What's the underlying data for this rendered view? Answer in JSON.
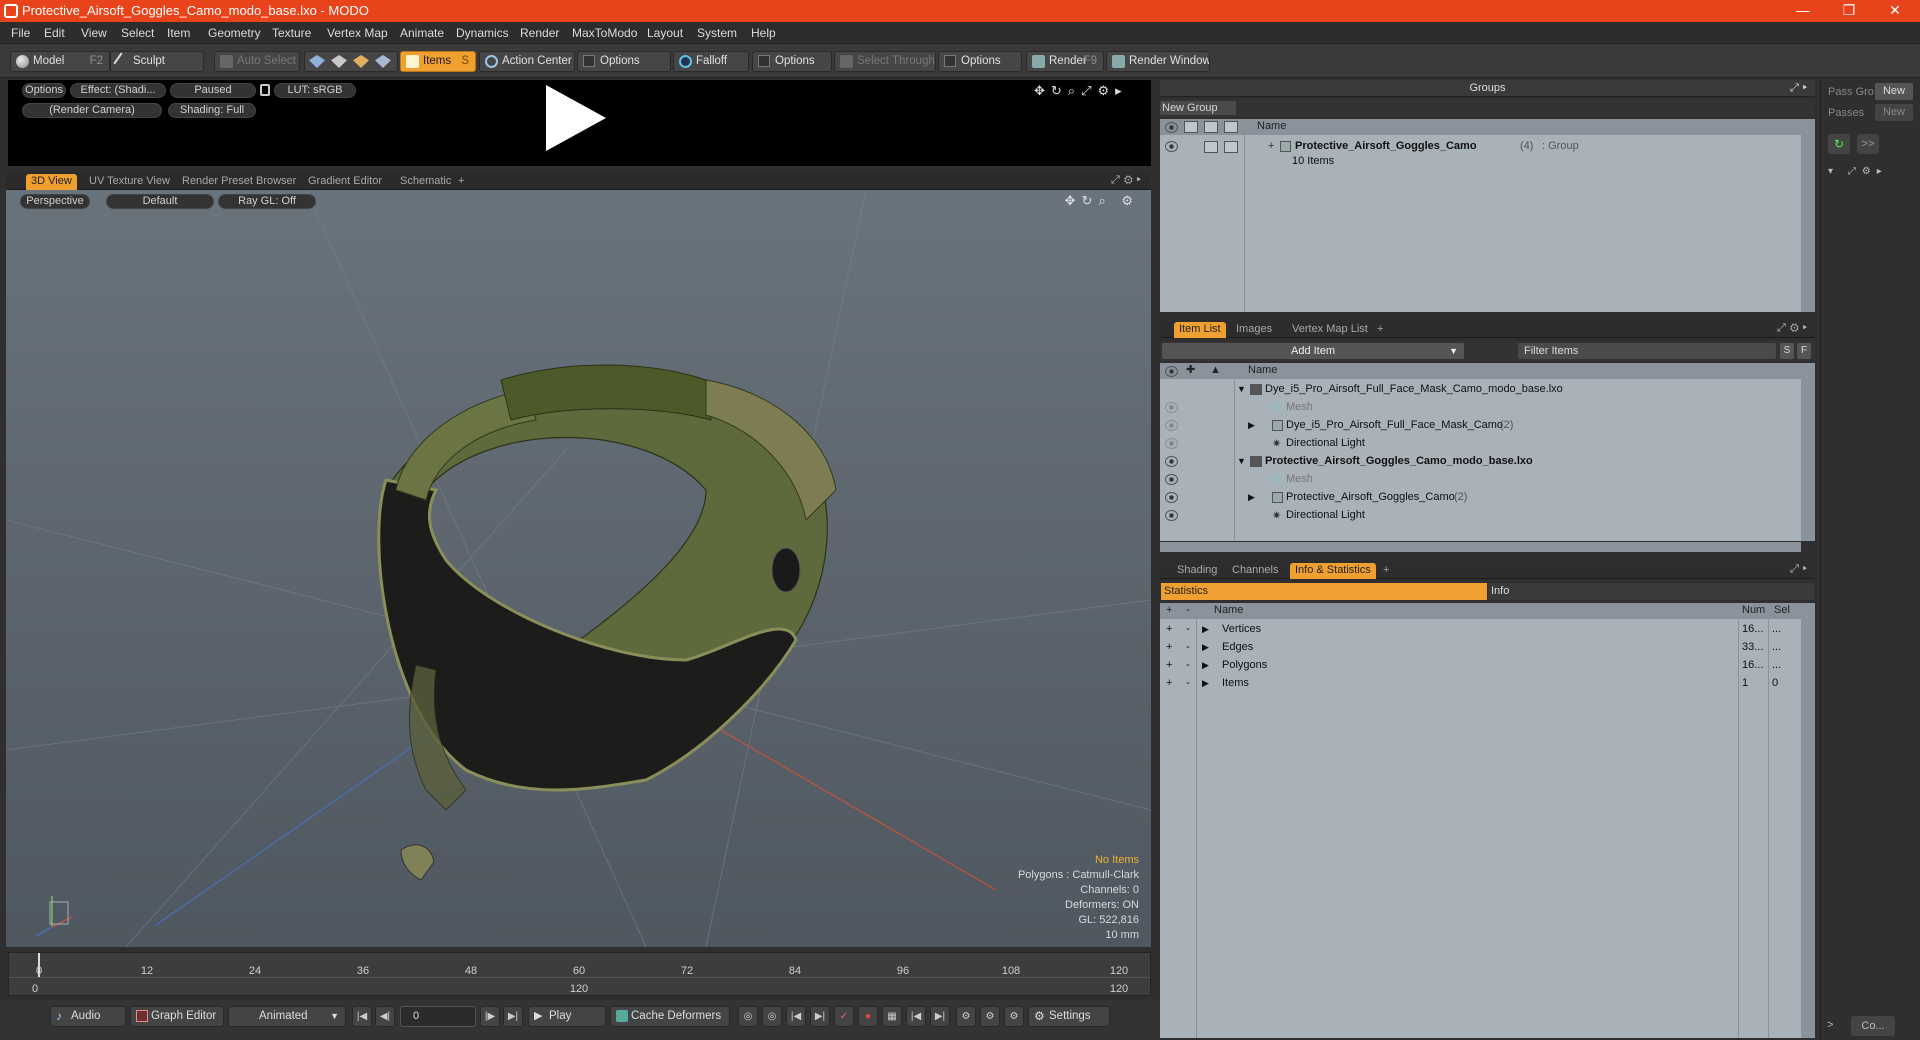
{
  "window": {
    "title": "Protective_Airsoft_Goggles_Camo_modo_base.lxo - MODO",
    "minimize": "—",
    "maximize": "❐",
    "close": "✕"
  },
  "menu": [
    "File",
    "Edit",
    "View",
    "Select",
    "Item",
    "Geometry",
    "Texture",
    "Vertex Map",
    "Animate",
    "Dynamics",
    "Render",
    "MaxToModo",
    "Layout",
    "System",
    "Help"
  ],
  "toolbar": {
    "model": "Model",
    "model_key": "F2",
    "sculpt": "Sculpt",
    "auto_select": "Auto Select",
    "items": "Items",
    "items_key": "S",
    "action_center": "Action Center",
    "options1": "Options",
    "falloff": "Falloff",
    "options2": "Options",
    "select_through": "Select Through",
    "options3": "Options",
    "render": "Render",
    "render_key": "F9",
    "render_window": "Render Window"
  },
  "preview": {
    "options": "Options",
    "effect": "Effect: (Shadi...",
    "paused": "Paused",
    "lut": "LUT: sRGB",
    "camera": "(Render Camera)",
    "shading": "Shading: Full"
  },
  "view_tabs": [
    "3D View",
    "UV Texture View",
    "Render Preset Browser",
    "Gradient Editor",
    "Schematic",
    "+"
  ],
  "viewport": {
    "perspective": "Perspective",
    "default": "Default",
    "raygl": "Ray GL: Off",
    "hud": {
      "no_items": "No Items",
      "polygons": "Polygons : Catmull-Clark",
      "channels": "Channels: 0",
      "deformers": "Deformers: ON",
      "gl": "GL: 522,816",
      "scale": "10 mm"
    }
  },
  "timeline": {
    "ticks": [
      "0",
      "12",
      "24",
      "36",
      "48",
      "60",
      "72",
      "84",
      "96",
      "108",
      "120"
    ],
    "frames": [
      "0",
      "120",
      "120"
    ]
  },
  "bottombar": {
    "audio": "Audio",
    "graph_editor": "Graph Editor",
    "animated": "Animated",
    "frame": "0",
    "play": "Play",
    "cache_deformers": "Cache Deformers",
    "settings": "Settings"
  },
  "groups": {
    "title": "Groups",
    "new_group": "New Group",
    "col_name": "Name",
    "row_name": "Protective_Airsoft_Goggles_Camo",
    "row_count": "(4)",
    "row_type": ": Group",
    "row_sub": "10 Items"
  },
  "pass": {
    "pass_groups": "Pass Gro",
    "passes": "Passes",
    "new1": "New",
    "new2": "New",
    "co": "Co..."
  },
  "itemlist": {
    "tabs": [
      "Item List",
      "Images",
      "Vertex Map List",
      "+"
    ],
    "add_item": "Add Item",
    "filter": "Filter Items",
    "s": "S",
    "f": "F",
    "col_name": "Name",
    "rows": [
      {
        "name": "Dye_i5_Pro_Airsoft_Full_Face_Mask_Camo_modo_base.lxo",
        "count": ""
      },
      {
        "name": "Mesh",
        "count": ""
      },
      {
        "name": "Dye_i5_Pro_Airsoft_Full_Face_Mask_Camo",
        "count": "(2)"
      },
      {
        "name": "Directional Light",
        "count": ""
      },
      {
        "name": "Protective_Airsoft_Goggles_Camo_modo_base.lxo",
        "count": ""
      },
      {
        "name": "Mesh",
        "count": ""
      },
      {
        "name": "Protective_Airsoft_Goggles_Camo",
        "count": "(2)"
      },
      {
        "name": "Directional Light",
        "count": ""
      }
    ]
  },
  "stats": {
    "tabs": [
      "Shading",
      "Channels",
      "Info & Statistics",
      "+"
    ],
    "statistics": "Statistics",
    "info": "Info",
    "col_name": "Name",
    "col_num": "Num",
    "col_sel": "Sel",
    "rows": [
      {
        "name": "Vertices",
        "num": "16...",
        "sel": "..."
      },
      {
        "name": "Edges",
        "num": "33...",
        "sel": "..."
      },
      {
        "name": "Polygons",
        "num": "16...",
        "sel": "..."
      },
      {
        "name": "Items",
        "num": "1",
        "sel": "0"
      }
    ]
  }
}
